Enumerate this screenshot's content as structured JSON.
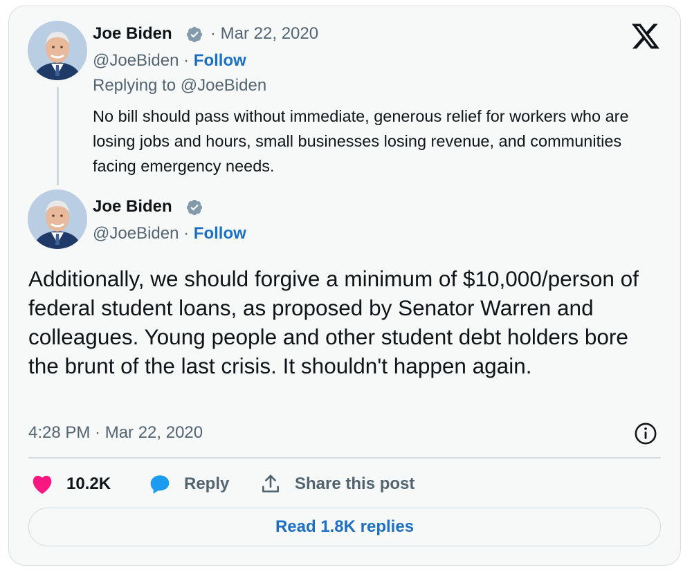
{
  "reply_tweet": {
    "author_name": "Joe Biden",
    "date": "· Mar 22, 2020",
    "handle": "@JoeBiden",
    "separator": " · ",
    "follow_label": "Follow",
    "replying_to": "Replying to @JoeBiden",
    "text": "No bill should pass without immediate, generous relief for workers who are losing jobs and hours, small businesses losing revenue, and communities facing emergency needs."
  },
  "main_tweet": {
    "author_name": "Joe Biden",
    "handle": "@JoeBiden",
    "separator": " · ",
    "follow_label": "Follow",
    "text": "Additionally, we should forgive a minimum of $10,000/person of federal student loans, as proposed by Senator Warren and colleagues. Young people and other student debt holders bore the brunt of the last crisis. It shouldn't happen again.",
    "timestamp": "4:28 PM · Mar 22, 2020"
  },
  "actions": {
    "like_count": "10.2K",
    "reply_label": "Reply",
    "share_label": "Share this post",
    "read_replies_label": "Read 1.8K replies"
  },
  "icons": {
    "brand": "x-logo-icon",
    "verified": "verified-badge-icon",
    "like": "heart-icon",
    "reply": "speech-bubble-icon",
    "share": "share-upload-icon",
    "info": "info-icon"
  },
  "colors": {
    "accent_link": "#1d6fc2",
    "like_red": "#f91880",
    "reply_blue": "#1d9bf0",
    "verified_gray": "#829aab",
    "muted_text": "#536471"
  }
}
